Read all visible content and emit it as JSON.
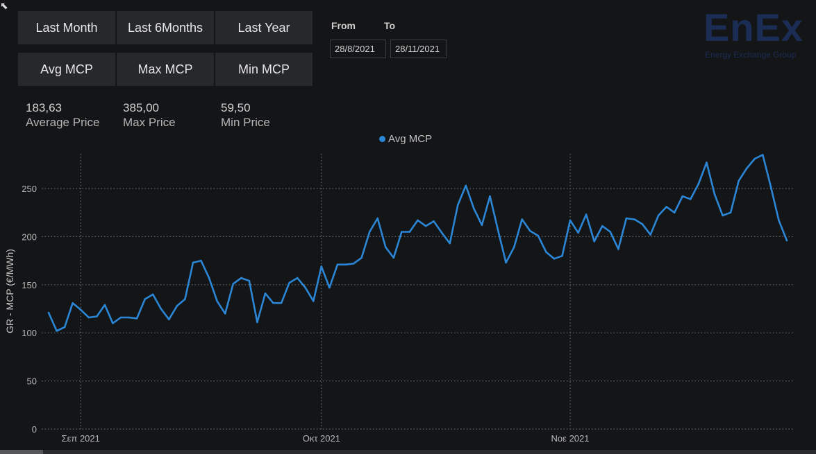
{
  "buttons": {
    "last_month": "Last Month",
    "last_6months": "Last 6Months",
    "last_year": "Last Year",
    "avg_mcp": "Avg MCP",
    "max_mcp": "Max MCP",
    "min_mcp": "Min MCP"
  },
  "date_range": {
    "from_label": "From",
    "to_label": "To",
    "from_value": "28/8/2021",
    "to_value": "28/11/2021"
  },
  "kpis": [
    {
      "value": "183,63",
      "label": "Average Price"
    },
    {
      "value": "385,00",
      "label": "Max Price"
    },
    {
      "value": "59,50",
      "label": "Min Price"
    }
  ],
  "logo": {
    "main": "EnEx",
    "sub": "Energy Exchange Group"
  },
  "colors": {
    "series": "#2b86d6",
    "background": "#141517",
    "button": "#26282b",
    "logo": "#1b2c55"
  },
  "chart_data": {
    "type": "line",
    "ylabel": "GR - MCP (€/MWh)",
    "xlabel": "",
    "legend_position": "top-center",
    "grid": "dotted",
    "ylim": [
      0,
      290
    ],
    "yticks": [
      0,
      50,
      100,
      150,
      200,
      250
    ],
    "x_tick_labels": [
      "Σεπ 2021",
      "Οκτ 2021",
      "Νοε 2021"
    ],
    "x_start": "2021-08-28",
    "x_end": "2021-11-28",
    "series": [
      {
        "name": "Avg MCP",
        "x": [
          "2021-08-28",
          "2021-08-29",
          "2021-08-30",
          "2021-08-31",
          "2021-09-01",
          "2021-09-02",
          "2021-09-03",
          "2021-09-04",
          "2021-09-05",
          "2021-09-06",
          "2021-09-07",
          "2021-09-08",
          "2021-09-09",
          "2021-09-10",
          "2021-09-11",
          "2021-09-12",
          "2021-09-13",
          "2021-09-14",
          "2021-09-15",
          "2021-09-16",
          "2021-09-17",
          "2021-09-18",
          "2021-09-19",
          "2021-09-20",
          "2021-09-21",
          "2021-09-22",
          "2021-09-23",
          "2021-09-24",
          "2021-09-25",
          "2021-09-26",
          "2021-09-27",
          "2021-09-28",
          "2021-09-29",
          "2021-09-30",
          "2021-10-01",
          "2021-10-02",
          "2021-10-03",
          "2021-10-04",
          "2021-10-05",
          "2021-10-06",
          "2021-10-07",
          "2021-10-08",
          "2021-10-09",
          "2021-10-10",
          "2021-10-11",
          "2021-10-12",
          "2021-10-13",
          "2021-10-14",
          "2021-10-15",
          "2021-10-16",
          "2021-10-17",
          "2021-10-18",
          "2021-10-19",
          "2021-10-20",
          "2021-10-21",
          "2021-10-22",
          "2021-10-23",
          "2021-10-24",
          "2021-10-25",
          "2021-10-26",
          "2021-10-27",
          "2021-10-28",
          "2021-10-29",
          "2021-10-30",
          "2021-10-31",
          "2021-11-01",
          "2021-11-02",
          "2021-11-03",
          "2021-11-04",
          "2021-11-05",
          "2021-11-06",
          "2021-11-07",
          "2021-11-08",
          "2021-11-09",
          "2021-11-10",
          "2021-11-11",
          "2021-11-12",
          "2021-11-13",
          "2021-11-14",
          "2021-11-15",
          "2021-11-16",
          "2021-11-17",
          "2021-11-18",
          "2021-11-19",
          "2021-11-20",
          "2021-11-21",
          "2021-11-22",
          "2021-11-23",
          "2021-11-24",
          "2021-11-25",
          "2021-11-26",
          "2021-11-27",
          "2021-11-28"
        ],
        "values": [
          121,
          102,
          106,
          131,
          124,
          116,
          117,
          129,
          110,
          116,
          116,
          115,
          135,
          140,
          125,
          114,
          128,
          135,
          173,
          175,
          157,
          133,
          120,
          151,
          157,
          154,
          111,
          141,
          131,
          131,
          152,
          157,
          147,
          133,
          169,
          147,
          171,
          171,
          172,
          178,
          205,
          219,
          189,
          178,
          205,
          205,
          217,
          211,
          216,
          204,
          193,
          233,
          253,
          229,
          212,
          242,
          207,
          173,
          189,
          218,
          206,
          201,
          184,
          177,
          180,
          217,
          204,
          223,
          195,
          211,
          205,
          187,
          219,
          218,
          213,
          202,
          222,
          231,
          225,
          242,
          239,
          255,
          277,
          244,
          222,
          225,
          258,
          271,
          281,
          285,
          252,
          217,
          196
        ]
      }
    ]
  }
}
